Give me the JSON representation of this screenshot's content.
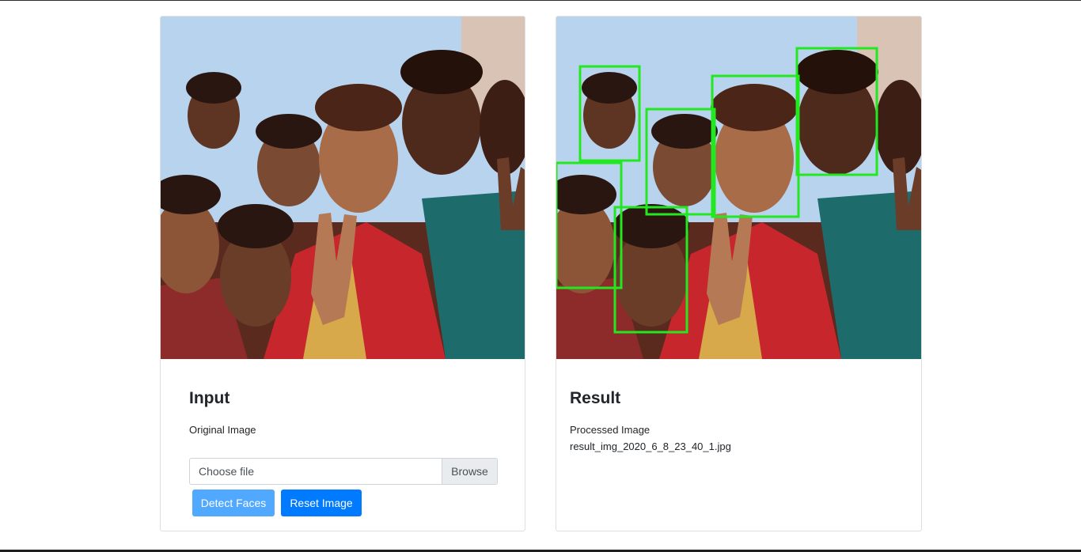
{
  "input_card": {
    "title": "Input",
    "subtitle": "Original Image",
    "file_placeholder": "Choose file",
    "browse_label": "Browse",
    "detect_label": "Detect Faces",
    "reset_label": "Reset Image"
  },
  "result_card": {
    "title": "Result",
    "subtitle": "Processed Image",
    "filename": "result_img_2020_6_8_23_40_1.jpg"
  },
  "colors": {
    "primary": "#007bff",
    "primary_disabled": "#51a8ff",
    "detection_box": "#22e81f"
  }
}
